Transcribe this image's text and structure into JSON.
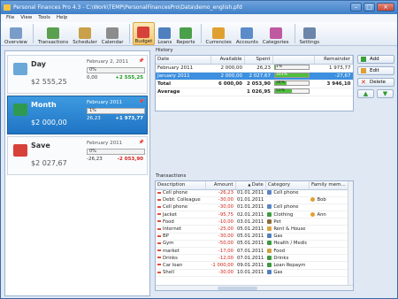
{
  "window": {
    "title": "Personal Finances Pro 4.3 - C:\\Work\\TEMP\\PersonalFinancesPro\\Data\\demo_english.pfd"
  },
  "menu": [
    "File",
    "View",
    "Tools",
    "Help"
  ],
  "toolbar": [
    {
      "label": "Overview",
      "color": "#7a9cc9"
    },
    {
      "label": "Transactions",
      "color": "#5aa050"
    },
    {
      "label": "Scheduler",
      "color": "#c9a14a"
    },
    {
      "label": "Calendar",
      "color": "#8c8c8c"
    },
    {
      "label": "Budget",
      "color": "#d6413a"
    },
    {
      "label": "Loans",
      "color": "#4f7fbf"
    },
    {
      "label": "Reports",
      "color": "#4aa04a"
    },
    {
      "label": "Currencies",
      "color": "#e0a030"
    },
    {
      "label": "Accounts",
      "color": "#5b8cc9"
    },
    {
      "label": "Categories",
      "color": "#c05aa0"
    },
    {
      "label": "Settings",
      "color": "#6b86a8"
    }
  ],
  "accounts": [
    {
      "name": "Day",
      "balance": "$2 555,25",
      "date": "February 2, 2011",
      "bar_text": "0%",
      "spent": "0,00",
      "remainder": "+2 555,25",
      "rem_color": "#1a9a1a",
      "icon_color": "#6aa8d8",
      "selected": false
    },
    {
      "name": "Month",
      "balance": "$2 000,00",
      "date": "February 2011",
      "bar_text": "1%",
      "spent": "26,23",
      "remainder": "+1 973,77",
      "rem_color": "#ffffff",
      "icon_color": "#2f9a4f",
      "selected": true
    },
    {
      "name": "Save",
      "balance": "$2 027,67",
      "date": "February 2011",
      "bar_text": "0%",
      "spent": "-26,23",
      "remainder": "-2 053,90",
      "rem_color": "#d0231a",
      "icon_color": "#d6413a",
      "selected": false
    }
  ],
  "history": {
    "title": "History",
    "columns": [
      "Date",
      "Available",
      "Spent",
      "",
      "Remainder"
    ],
    "rows": [
      {
        "date": "February 2011",
        "available": "2 000,00",
        "spent": "26,23",
        "pct": "1%",
        "fill": 0.01,
        "remainder": "1 973,77",
        "selected": false
      },
      {
        "date": "January 2011",
        "available": "2 000,00",
        "spent": "2 027,67",
        "pct": "101%",
        "fill": 1.0,
        "remainder": "-27,67",
        "selected": true
      },
      {
        "date": "Total",
        "available": "6 000,00",
        "spent": "2 053,90",
        "pct": "34%",
        "fill": 0.34,
        "remainder": "3 946,10",
        "selected": false,
        "bold": true
      },
      {
        "date": "Average",
        "available": "",
        "spent": "1 026,95",
        "pct": "51%",
        "fill": 0.51,
        "remainder": "",
        "selected": false,
        "bold": true
      }
    ]
  },
  "buttons": {
    "add": "Add",
    "edit": "Edit",
    "delete": "Delete"
  },
  "transactions": {
    "title": "Transactions",
    "columns": [
      "Description",
      "Amount",
      "Date",
      "Category",
      "Family mem..."
    ],
    "rows": [
      {
        "desc": "Cell phone",
        "amount": "-26,23",
        "date": "01.01.2011",
        "category": "Cell phone",
        "member": "",
        "cat_color": "#5a86c4"
      },
      {
        "desc": "Debt: Colleague",
        "amount": "-30,00",
        "date": "01.01.2011",
        "category": "",
        "member": "Bob",
        "cat_color": "#5a86c4"
      },
      {
        "desc": "Cell phone",
        "amount": "-30,00",
        "date": "01.01.2011",
        "category": "Cell phone",
        "member": "",
        "cat_color": "#5a86c4"
      },
      {
        "desc": "Jacket",
        "amount": "-95,75",
        "date": "02.01.2011",
        "category": "Clothing",
        "member": "Ann",
        "cat_color": "#3e9a3e"
      },
      {
        "desc": "Food",
        "amount": "-10,00",
        "date": "03.01.2011",
        "category": "Pet",
        "member": "",
        "cat_color": "#8a6a3a"
      },
      {
        "desc": "Internet",
        "amount": "-25,00",
        "date": "05.01.2011",
        "category": "Rent & House",
        "member": "",
        "cat_color": "#d9a441"
      },
      {
        "desc": "BP",
        "amount": "-30,00",
        "date": "05.01.2011",
        "category": "Gas",
        "member": "",
        "cat_color": "#4f7fbf"
      },
      {
        "desc": "Gym",
        "amount": "-50,00",
        "date": "05.01.2011",
        "category": "Health / Medic",
        "member": "",
        "cat_color": "#3e9a3e"
      },
      {
        "desc": "market",
        "amount": "-17,00",
        "date": "07.01.2011",
        "category": "Food",
        "member": "",
        "cat_color": "#d0a040"
      },
      {
        "desc": "Drinks",
        "amount": "-12,00",
        "date": "07.01.2011",
        "category": "Drinks",
        "member": "",
        "cat_color": "#3e9a3e"
      },
      {
        "desc": "Car loan",
        "amount": "-1 000,00",
        "date": "09.01.2011",
        "category": "Loan Repaym",
        "member": "",
        "cat_color": "#3e9a3e"
      },
      {
        "desc": "Shell",
        "amount": "-30,00",
        "date": "10.01.2011",
        "category": "Gas",
        "member": "",
        "cat_color": "#4f7fbf"
      }
    ]
  }
}
